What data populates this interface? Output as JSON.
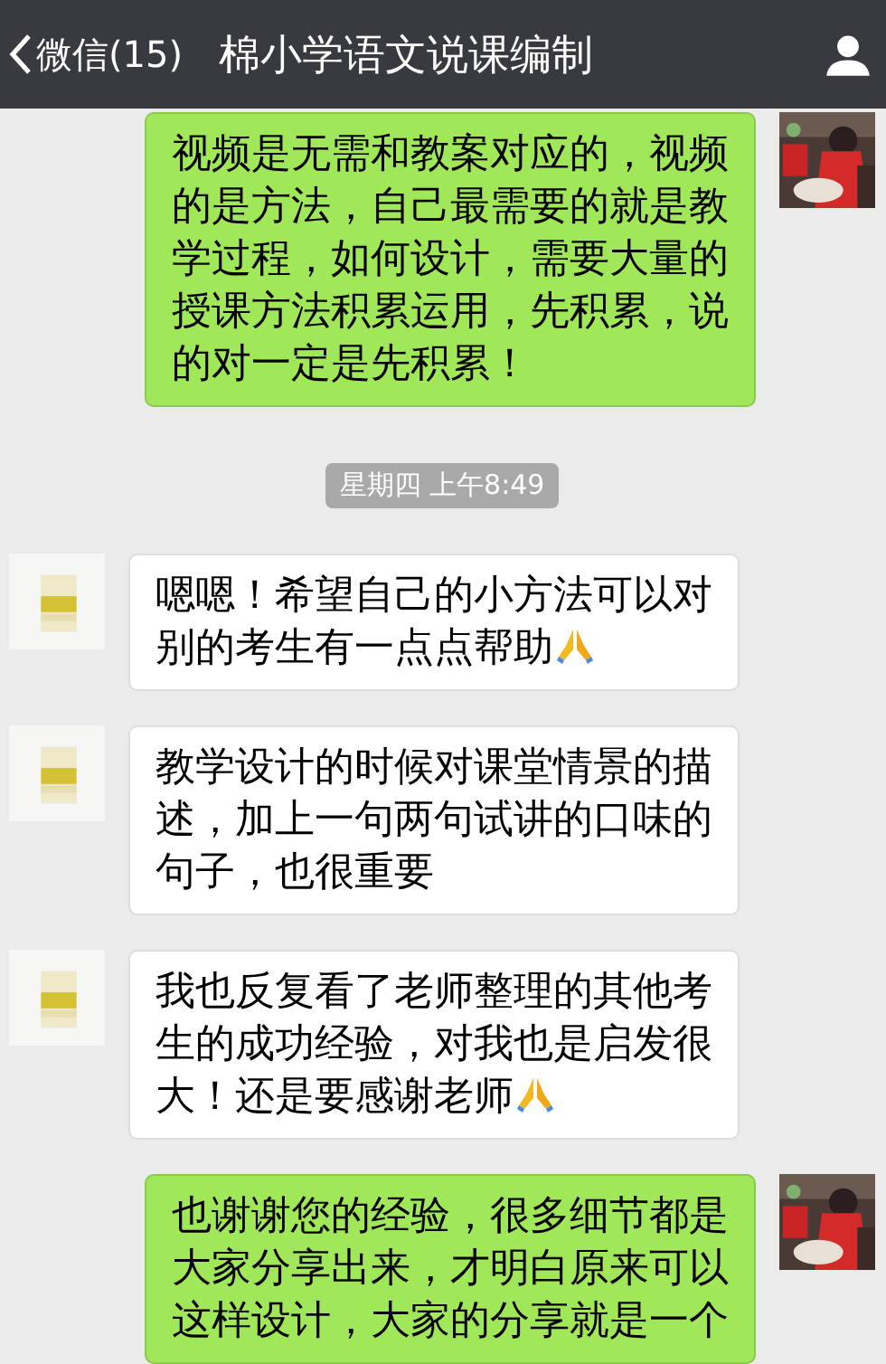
{
  "header": {
    "back_label": "微信(15)",
    "title": "棉小学语文说课编制"
  },
  "messages": [
    {
      "kind": "sent",
      "text": "视频是无需和教案对应的，视频的是方法，自己最需要的就是教学过程，如何设计，需要大量的授课方法积累运用，先积累，说的对一定是先积累！"
    },
    {
      "kind": "time",
      "text": "星期四 上午8:49"
    },
    {
      "kind": "received",
      "text": "嗯嗯！希望自己的小方法可以对别的考生有一点点帮助",
      "ends_with_emoji": true
    },
    {
      "kind": "received",
      "text": "教学设计的时候对课堂情景的描述，加上一句两句试讲的口味的句子，也很重要"
    },
    {
      "kind": "received",
      "text": "我也反复看了老师整理的其他考生的成功经验，对我也是启发很大！还是要感谢老师",
      "ends_with_emoji": true
    },
    {
      "kind": "sent",
      "text": "也谢谢您的经验，很多细节都是大家分享出来，才明白原来可以这样设计，大家的分享就是一个"
    }
  ]
}
